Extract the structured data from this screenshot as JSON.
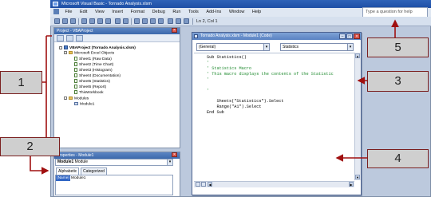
{
  "window": {
    "title": "Microsoft Visual Basic - Tornado Analysis.xlsm"
  },
  "menu": [
    "File",
    "Edit",
    "View",
    "Insert",
    "Format",
    "Debug",
    "Run",
    "Tools",
    "Add-Ins",
    "Window",
    "Help"
  ],
  "help_search": {
    "placeholder": "Type a question for help"
  },
  "toolbar": {
    "cursor_position": "Ln 2, Col 1"
  },
  "project_explorer": {
    "title": "Project - VBAProject",
    "root": "VBAProject (Tornado Analysis.xlsm)",
    "excel_objects_folder": "Microsoft Excel Objects",
    "sheets": [
      "Sheet1 (Raw Data)",
      "Sheet2 (Time Chart)",
      "Sheet3 (Histogram)",
      "Sheet4 (Documentation)",
      "Sheet5 (Statistics)",
      "Sheet6 (Report)",
      "ThisWorkbook"
    ],
    "modules_folder": "Modules",
    "modules": [
      "Module1"
    ]
  },
  "properties": {
    "title": "Properties - Module1",
    "object_name": "Module1",
    "object_type": "Module",
    "tabs": [
      "Alphabetic",
      "Categorized"
    ],
    "row_name": "(Name)",
    "row_value": "Module1"
  },
  "code_window": {
    "title": "Tornado Analysis.xlsm - Module1 (Code)",
    "object_combo": "(General)",
    "procedure_combo": "Statistics",
    "lines": [
      {
        "text": "Sub Statistics()",
        "type": "code"
      },
      {
        "text": "'",
        "type": "comment"
      },
      {
        "text": "' Statistics Macro",
        "type": "comment"
      },
      {
        "text": "' This macro displays the contents of the Statistic",
        "type": "comment"
      },
      {
        "text": "'",
        "type": "comment"
      },
      {
        "text": "",
        "type": "code"
      },
      {
        "text": "'",
        "type": "comment"
      },
      {
        "text": "    Sheets(\"Statistics\").Select",
        "type": "code"
      },
      {
        "text": "    Range(\"A1\").Select",
        "type": "code"
      },
      {
        "text": "End Sub",
        "type": "code"
      }
    ]
  },
  "callouts": [
    "1",
    "2",
    "3",
    "4",
    "5"
  ],
  "colors": {
    "callout_arrow": "#a01010",
    "callout_fill": "#cfcfcf",
    "titlebar": "#2f63b8"
  }
}
